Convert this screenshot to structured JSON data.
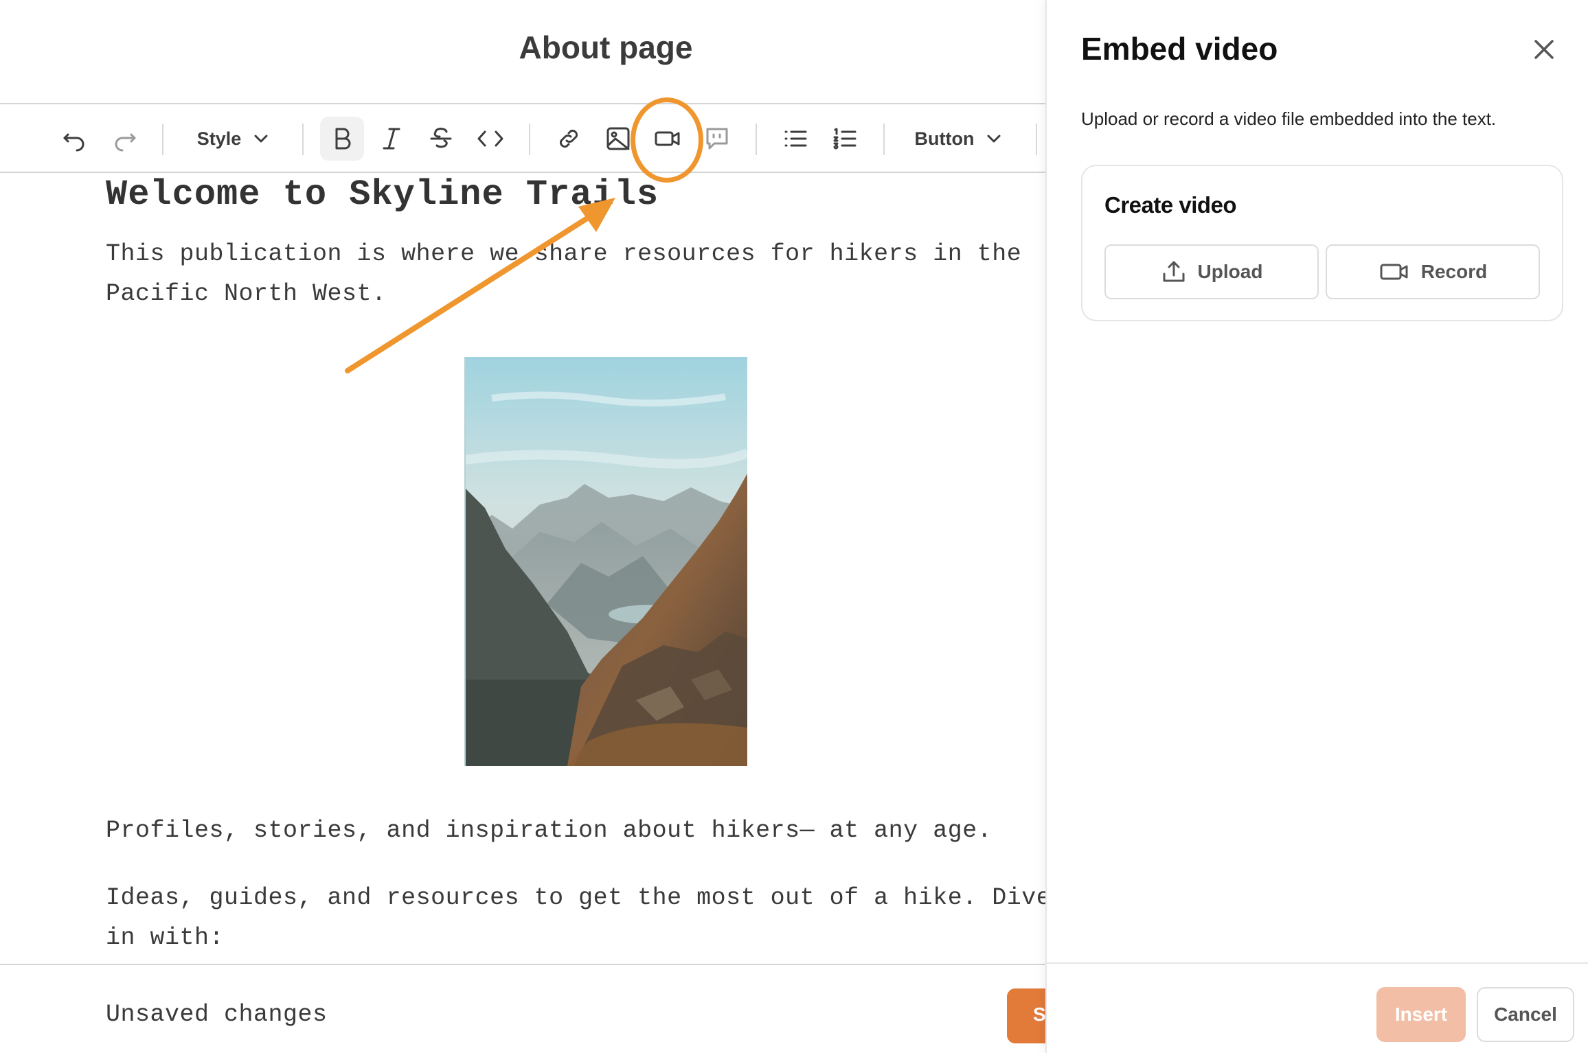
{
  "editor": {
    "title": "About page",
    "toolbar": {
      "style_label": "Style",
      "button_label": "Button"
    },
    "content": {
      "heading": "Welcome to Skyline Trails",
      "paragraph1_line1": "This publication is where we share resources for hikers in the",
      "paragraph1_line2": "Pacific North West.",
      "paragraph2": "Profiles, stories, and inspiration about hikers— at any age.",
      "paragraph3_line1": "Ideas, guides, and resources to get the most out of a hike. Dive",
      "paragraph3_line2": "in with:"
    },
    "footer": {
      "status": "Unsaved changes",
      "save_label": "S"
    }
  },
  "panel": {
    "title": "Embed video",
    "description": "Upload or record a video file embedded into the text.",
    "card_title": "Create video",
    "upload_label": "Upload",
    "record_label": "Record",
    "insert_label": "Insert",
    "cancel_label": "Cancel"
  },
  "colors": {
    "accent_orange": "#f0962e",
    "save_button": "#e27a3a",
    "insert_disabled": "#f2bea5"
  }
}
